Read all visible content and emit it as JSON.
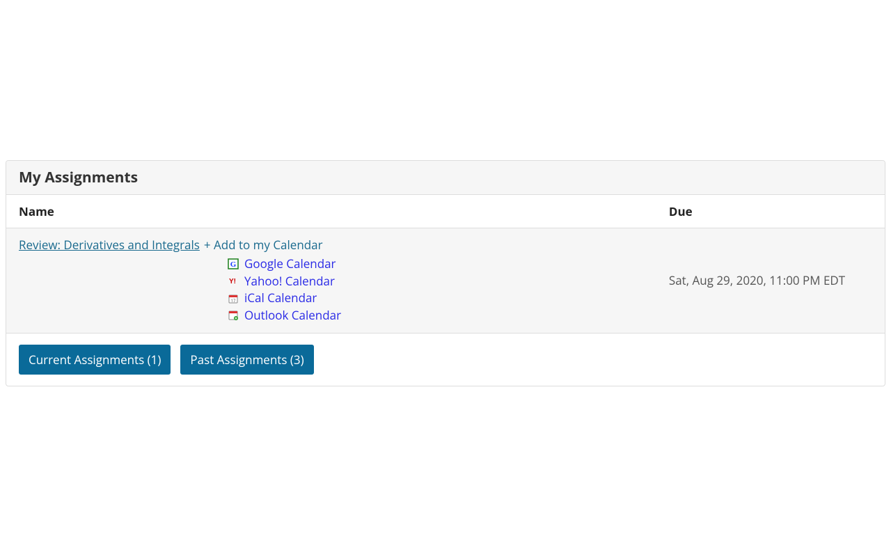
{
  "panel": {
    "title": "My Assignments",
    "columns": {
      "name": "Name",
      "due": "Due"
    }
  },
  "assignment": {
    "name": "Review: Derivatives and Integrals",
    "add_label": "+ Add to my Calendar",
    "due": "Sat, Aug 29, 2020, 11:00 PM EDT",
    "calendars": {
      "google": "Google Calendar",
      "yahoo": "Yahoo! Calendar",
      "ical": "iCal Calendar",
      "outlook": "Outlook Calendar"
    }
  },
  "buttons": {
    "current": "Current Assignments (1)",
    "past": "Past Assignments (3)"
  }
}
